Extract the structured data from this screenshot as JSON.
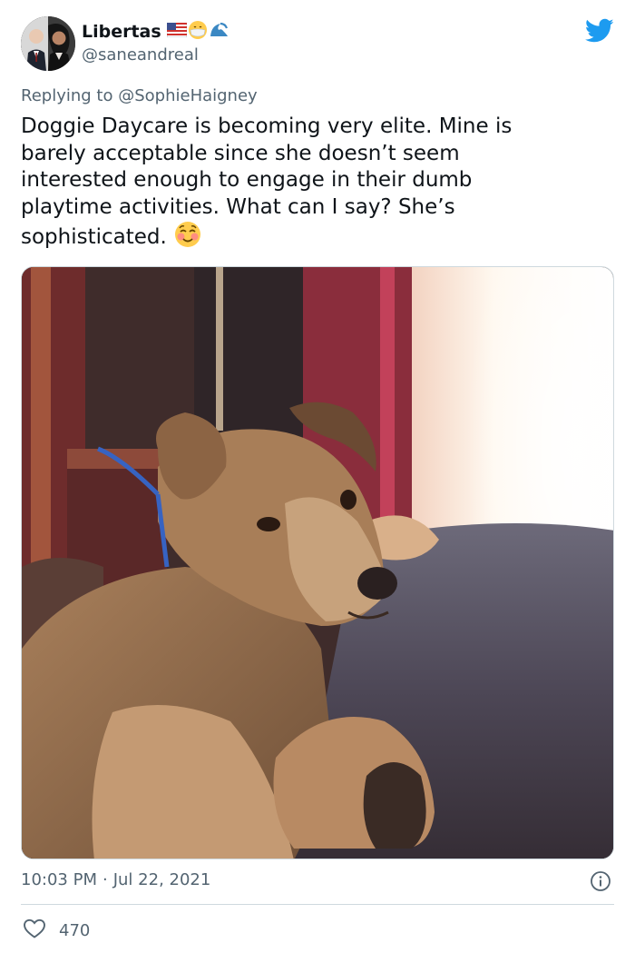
{
  "author": {
    "display_name": "Libertas",
    "handle": "@saneandreal",
    "name_emojis": [
      "us-flag-icon",
      "mask-face-icon",
      "wave-icon"
    ]
  },
  "reply": {
    "prefix": "Replying to",
    "mention": "@SophieHaigney"
  },
  "tweet": {
    "lines": [
      "Doggie Daycare is becoming very elite. Mine is",
      "barely acceptable since she doesn’t seem",
      "interested enough to engage in their dumb",
      "playtime activities. What can I say? She’s",
      "sophisticated."
    ],
    "trailing_emoji": "smiling-blush-face-icon"
  },
  "meta": {
    "time": "10:03 PM",
    "separator": "·",
    "date": "Jul 22, 2021"
  },
  "engagement": {
    "likes": "470"
  },
  "colors": {
    "twitter_blue": "#1d9bf0",
    "secondary_text": "#536471",
    "divider": "#cfd9de"
  }
}
